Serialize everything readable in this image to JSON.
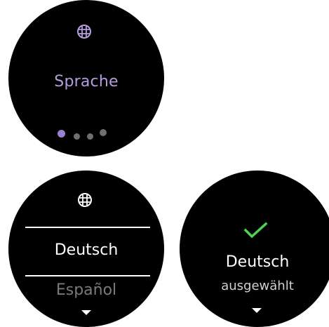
{
  "screens": {
    "intro": {
      "title": "Sprache",
      "icon": "globe-icon",
      "accent_color": "#b69de0",
      "page_indicator": {
        "count": 4,
        "active_index": 0,
        "active_color": "#9b7fd0",
        "inactive_color": "#6f6f6f"
      }
    },
    "picker": {
      "icon": "globe-icon",
      "selected_option": "Deutsch",
      "next_option": "Español",
      "scroll_hint_icon": "caret-down-icon"
    },
    "confirm": {
      "icon": "checkmark-icon",
      "check_color": "#4cd34f",
      "language": "Deutsch",
      "status": "ausgewählt",
      "scroll_hint_icon": "caret-down-icon"
    }
  }
}
